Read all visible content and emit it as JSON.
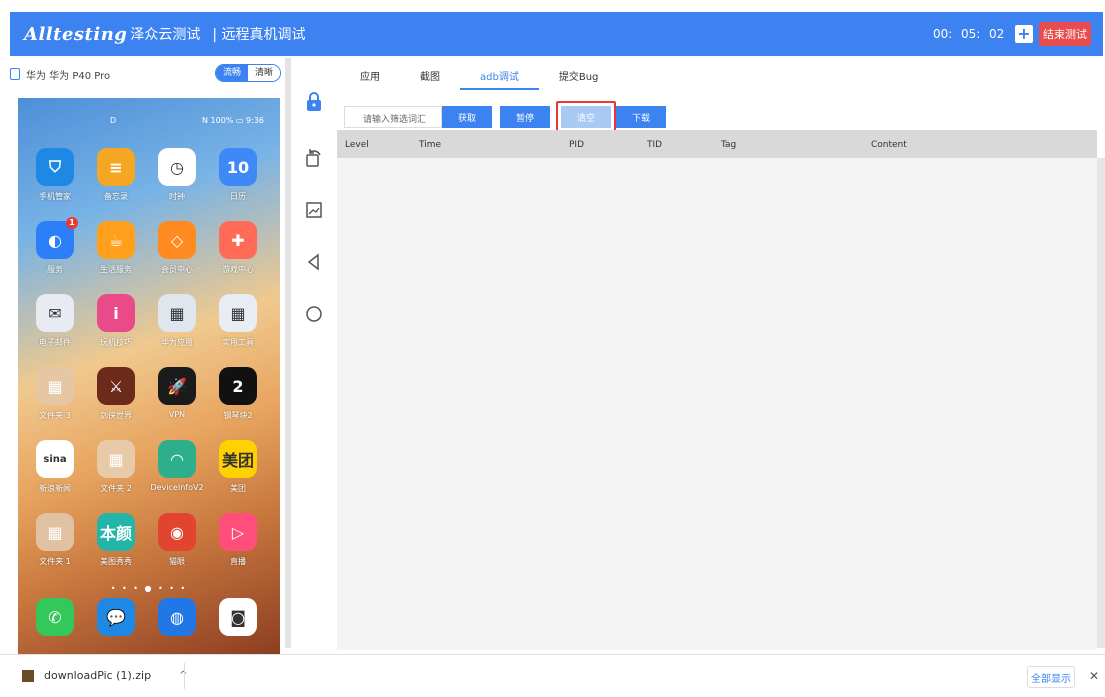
{
  "header": {
    "logo": "Alltesting",
    "logo_cn": "泽众云测试",
    "title": "| 远程真机调试",
    "timer": {
      "h": "00:",
      "m": "05:",
      "s": "02"
    },
    "add_label": "+",
    "end_label": "结束测试",
    "color": "#3c82f0"
  },
  "device": {
    "name": "华为 华为 P40 Pro",
    "quality_smooth": "流畅",
    "quality_hd": "清晰"
  },
  "phone": {
    "status_left": "D",
    "status_right": "N 100% ▭ 9:36",
    "apps": [
      {
        "label": "手机管家",
        "icon": "shield-icon",
        "glyph": "⛉",
        "color": "#1e88e5"
      },
      {
        "label": "备忘录",
        "icon": "memo-icon",
        "glyph": "≡",
        "color": "#f5a623"
      },
      {
        "label": "时钟",
        "icon": "clock-icon",
        "glyph": "◷",
        "color": "#ffffff"
      },
      {
        "label": "日历",
        "icon": "calendar-icon",
        "glyph": "10",
        "color": "#3d8af7"
      },
      {
        "label": "服务",
        "icon": "service-icon",
        "glyph": "◐",
        "color": "#2d7ff9",
        "badge": "1"
      },
      {
        "label": "生活服务",
        "icon": "cup-icon",
        "glyph": "☕",
        "color": "#ff9f1c"
      },
      {
        "label": "会员中心",
        "icon": "diamond-icon",
        "glyph": "◇",
        "color": "#ff8a1f"
      },
      {
        "label": "游戏中心",
        "icon": "gamepad-icon",
        "glyph": "✚",
        "color": "#ff6b57"
      },
      {
        "label": "电子邮件",
        "icon": "mail-icon",
        "glyph": "✉",
        "color": "#e8ecf2"
      },
      {
        "label": "玩机技巧",
        "icon": "tips-icon",
        "glyph": "i",
        "color": "#e84a8a"
      },
      {
        "label": "华为应用",
        "icon": "folder-icon",
        "glyph": "▦",
        "color": "#dfe6ee"
      },
      {
        "label": "实用工具",
        "icon": "tools-folder-icon",
        "glyph": "▦",
        "color": "#e7edf3"
      },
      {
        "label": "文件夹 3",
        "icon": "folder-icon",
        "glyph": "▦",
        "color": "#e6c7a3"
      },
      {
        "label": "剑侠世界",
        "icon": "game-icon",
        "glyph": "⚔",
        "color": "#6b2a1a"
      },
      {
        "label": "VPN",
        "icon": "rocket-icon",
        "glyph": "🚀",
        "color": "#1b1b1b"
      },
      {
        "label": "钢琴块2",
        "icon": "piano-icon",
        "glyph": "2",
        "color": "#111111"
      },
      {
        "label": "新浪新闻",
        "icon": "sina-icon",
        "glyph": "sina",
        "color": "#ffffff"
      },
      {
        "label": "文件夹 2",
        "icon": "folder-icon",
        "glyph": "▦",
        "color": "#e8c9a8"
      },
      {
        "label": "DeviceInfoV2",
        "icon": "android-icon",
        "glyph": "◠",
        "color": "#2eaf8c"
      },
      {
        "label": "美团",
        "icon": "meituan-icon",
        "glyph": "美团",
        "color": "#ffd100"
      },
      {
        "label": "文件夹 1",
        "icon": "folder-icon",
        "glyph": "▦",
        "color": "#e0c2a2"
      },
      {
        "label": "美图秀秀",
        "icon": "beauty-icon",
        "glyph": "本颜",
        "color": "#22b5a8"
      },
      {
        "label": "猫眼",
        "icon": "cat-icon",
        "glyph": "◉",
        "color": "#e2452f"
      },
      {
        "label": "直播",
        "icon": "live-icon",
        "glyph": "▷",
        "color": "#ff4e7a"
      }
    ],
    "dock": [
      {
        "icon": "phone-icon",
        "glyph": "✆",
        "color": "#34c759"
      },
      {
        "icon": "message-icon",
        "glyph": "💬",
        "color": "#1e88e5"
      },
      {
        "icon": "browser-icon",
        "glyph": "◍",
        "color": "#2277e6"
      },
      {
        "icon": "camera-icon",
        "glyph": "◙",
        "color": "#ffffff"
      }
    ]
  },
  "tabs": [
    "应用",
    "截图",
    "adb调试",
    "提交Bug"
  ],
  "active_tab": "adb调试",
  "filter": {
    "placeholder": "请输入筛选词汇",
    "get": "获取",
    "pause": "暂停",
    "clear": "清空",
    "download": "下载"
  },
  "log_table": {
    "columns": [
      "Level",
      "Time",
      "PID",
      "TID",
      "Tag",
      "Content"
    ],
    "rows": []
  },
  "download_bar": {
    "file": "downloadPic (1).zip",
    "show_all": "全部显示",
    "close": "✕"
  }
}
